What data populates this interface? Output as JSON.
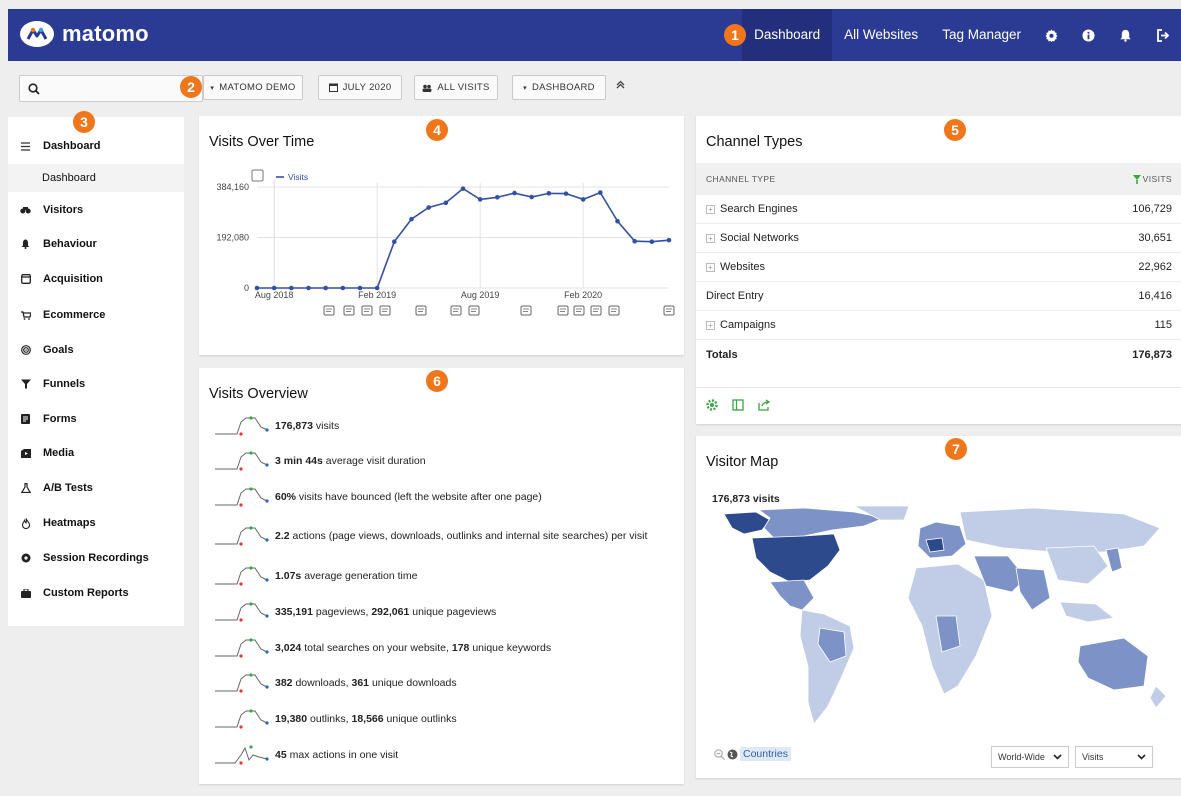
{
  "brand": {
    "name": "matomo"
  },
  "nav": {
    "dashboard": "Dashboard",
    "all_websites": "All Websites",
    "tag_manager": "Tag Manager"
  },
  "badges": [
    "1",
    "2",
    "3",
    "4",
    "5",
    "6",
    "7"
  ],
  "selectors": {
    "site": "MATOMO DEMO",
    "date": "JULY 2020",
    "segment": "ALL VISITS",
    "dashboard": "DASHBOARD"
  },
  "sidebar": {
    "items": [
      {
        "label": "Dashboard",
        "icon": "grid-icon"
      },
      {
        "label": "Visitors",
        "icon": "binoculars-icon"
      },
      {
        "label": "Behaviour",
        "icon": "bell-icon"
      },
      {
        "label": "Acquisition",
        "icon": "window-icon"
      },
      {
        "label": "Ecommerce",
        "icon": "cart-icon"
      },
      {
        "label": "Goals",
        "icon": "target-icon"
      },
      {
        "label": "Funnels",
        "icon": "funnel-icon"
      },
      {
        "label": "Forms",
        "icon": "form-icon"
      },
      {
        "label": "Media",
        "icon": "media-icon"
      },
      {
        "label": "A/B Tests",
        "icon": "flask-icon"
      },
      {
        "label": "Heatmaps",
        "icon": "flame-icon"
      },
      {
        "label": "Session Recordings",
        "icon": "record-icon"
      },
      {
        "label": "Custom Reports",
        "icon": "briefcase-icon"
      }
    ],
    "sub_dashboard": "Dashboard"
  },
  "visits_over_time": {
    "title": "Visits Over Time",
    "legend": "Visits"
  },
  "chart_data": {
    "type": "line",
    "title": "Visits Over Time",
    "x_ticks": [
      "Aug 2018",
      "Feb 2019",
      "Aug 2019",
      "Feb 2020"
    ],
    "y_ticks": [
      "0",
      "192,080",
      "384,160"
    ],
    "ylim": [
      0,
      384160
    ],
    "series": [
      {
        "name": "Visits",
        "x": [
          "2018-07",
          "2018-08",
          "2018-09",
          "2018-10",
          "2018-11",
          "2018-12",
          "2019-01",
          "2019-02",
          "2019-03",
          "2019-04",
          "2019-05",
          "2019-06",
          "2019-07",
          "2019-08",
          "2019-09",
          "2019-10",
          "2019-11",
          "2019-12",
          "2020-01",
          "2020-02",
          "2020-03",
          "2020-04",
          "2020-05",
          "2020-06",
          "2020-07"
        ],
        "values": [
          0,
          0,
          0,
          0,
          0,
          0,
          0,
          0,
          176000,
          262000,
          306000,
          324000,
          378000,
          337000,
          345000,
          361000,
          346000,
          360000,
          359000,
          337000,
          363000,
          254000,
          178000,
          176000,
          182000
        ]
      }
    ],
    "grid": true
  },
  "channel_types": {
    "title": "Channel Types",
    "col_label": "CHANNEL TYPE",
    "col_value": "VISITS",
    "rows": [
      {
        "label": "Search Engines",
        "value": "106,729"
      },
      {
        "label": "Social Networks",
        "value": "30,651"
      },
      {
        "label": "Websites",
        "value": "22,962"
      },
      {
        "label": "Direct Entry",
        "value": "16,416"
      },
      {
        "label": "Campaigns",
        "value": "115"
      }
    ],
    "total_label": "Totals",
    "total_value": "176,873"
  },
  "visits_overview": {
    "title": "Visits Overview",
    "rows": [
      {
        "b1": "176,873",
        "t1": " visits",
        "b2": "",
        "t2": ""
      },
      {
        "b1": "3 min 44s",
        "t1": " average visit duration",
        "b2": "",
        "t2": ""
      },
      {
        "b1": "60%",
        "t1": " visits have bounced (left the website after one page)",
        "b2": "",
        "t2": ""
      },
      {
        "b1": "2.2",
        "t1": " actions (page views, downloads, outlinks and internal site searches) per visit",
        "b2": "",
        "t2": ""
      },
      {
        "b1": "1.07s",
        "t1": " average generation time",
        "b2": "",
        "t2": ""
      },
      {
        "b1": "335,191",
        "t1": " pageviews, ",
        "b2": "292,061",
        "t2": " unique pageviews"
      },
      {
        "b1": "3,024",
        "t1": " total searches on your website, ",
        "b2": "178",
        "t2": " unique keywords"
      },
      {
        "b1": "382",
        "t1": " downloads, ",
        "b2": "361",
        "t2": " unique downloads"
      },
      {
        "b1": "19,380",
        "t1": " outlinks, ",
        "b2": "18,566",
        "t2": " unique outlinks"
      },
      {
        "b1": "45",
        "t1": " max actions in one visit",
        "b2": "",
        "t2": ""
      }
    ]
  },
  "visitor_map": {
    "title": "Visitor Map",
    "visits_label": "176,873 visits",
    "countries_link": "Countries",
    "region_select": "World-Wide",
    "metric_select": "Visits"
  },
  "colors": {
    "topbar": "#2b3a93",
    "badge": "#f0761b",
    "line": "#3450a1",
    "map_dark": "#2c4a8c",
    "map_mid": "#7d93c7",
    "map_light": "#c1cce6"
  }
}
